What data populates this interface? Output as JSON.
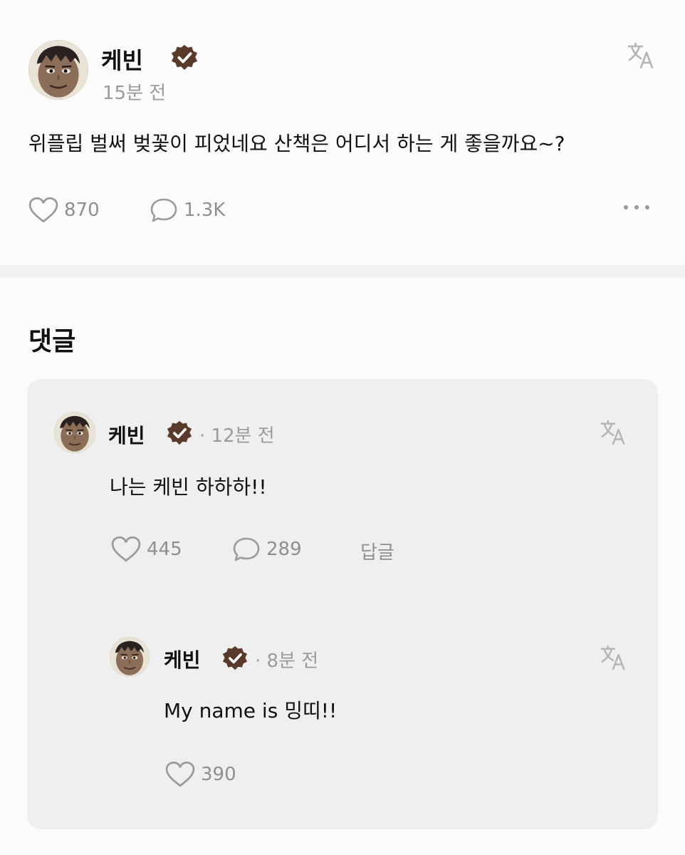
{
  "post": {
    "author": "케빈",
    "verified_icon": "verified-badge-icon",
    "time": "15분 전",
    "text": "위플립 벌써 벚꽃이 피었네요 산책은 어디서 하는 게 좋을까요~?",
    "likes": "870",
    "comments": "1.3K"
  },
  "comments_section": {
    "title": "댓글",
    "comments": [
      {
        "author": "케빈",
        "time": "· 12분 전",
        "text": "나는 케빈 하하하!!",
        "likes": "445",
        "replies": "289",
        "reply_label": "답글",
        "children": [
          {
            "author": "케빈",
            "time": "· 8분 전",
            "text": "My name is 밍띠!!",
            "likes": "390"
          }
        ]
      }
    ]
  },
  "colors": {
    "verified_badge": "#5a3a2a",
    "muted_text": "#9b9b9b",
    "card_background": "#f0efef",
    "page_background": "#fcfbfb"
  }
}
